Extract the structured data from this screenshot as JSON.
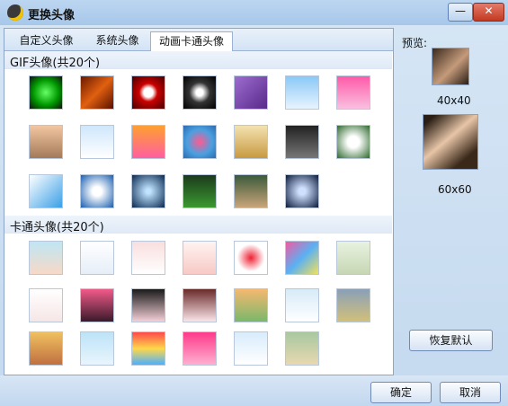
{
  "window": {
    "title": "更换头像",
    "minimize": "—",
    "close": "✕"
  },
  "tabs": [
    {
      "label": "自定义头像"
    },
    {
      "label": "系统头像"
    },
    {
      "label": "动画卡通头像"
    }
  ],
  "sections": {
    "gif": "GIF头像(共20个)",
    "cartoon": "卡通头像(共20个)"
  },
  "preview": {
    "label": "预览:",
    "size40": "40x40",
    "size60": "60x60"
  },
  "buttons": {
    "restore": "恢复默认",
    "ok": "确定",
    "cancel": "取消"
  }
}
